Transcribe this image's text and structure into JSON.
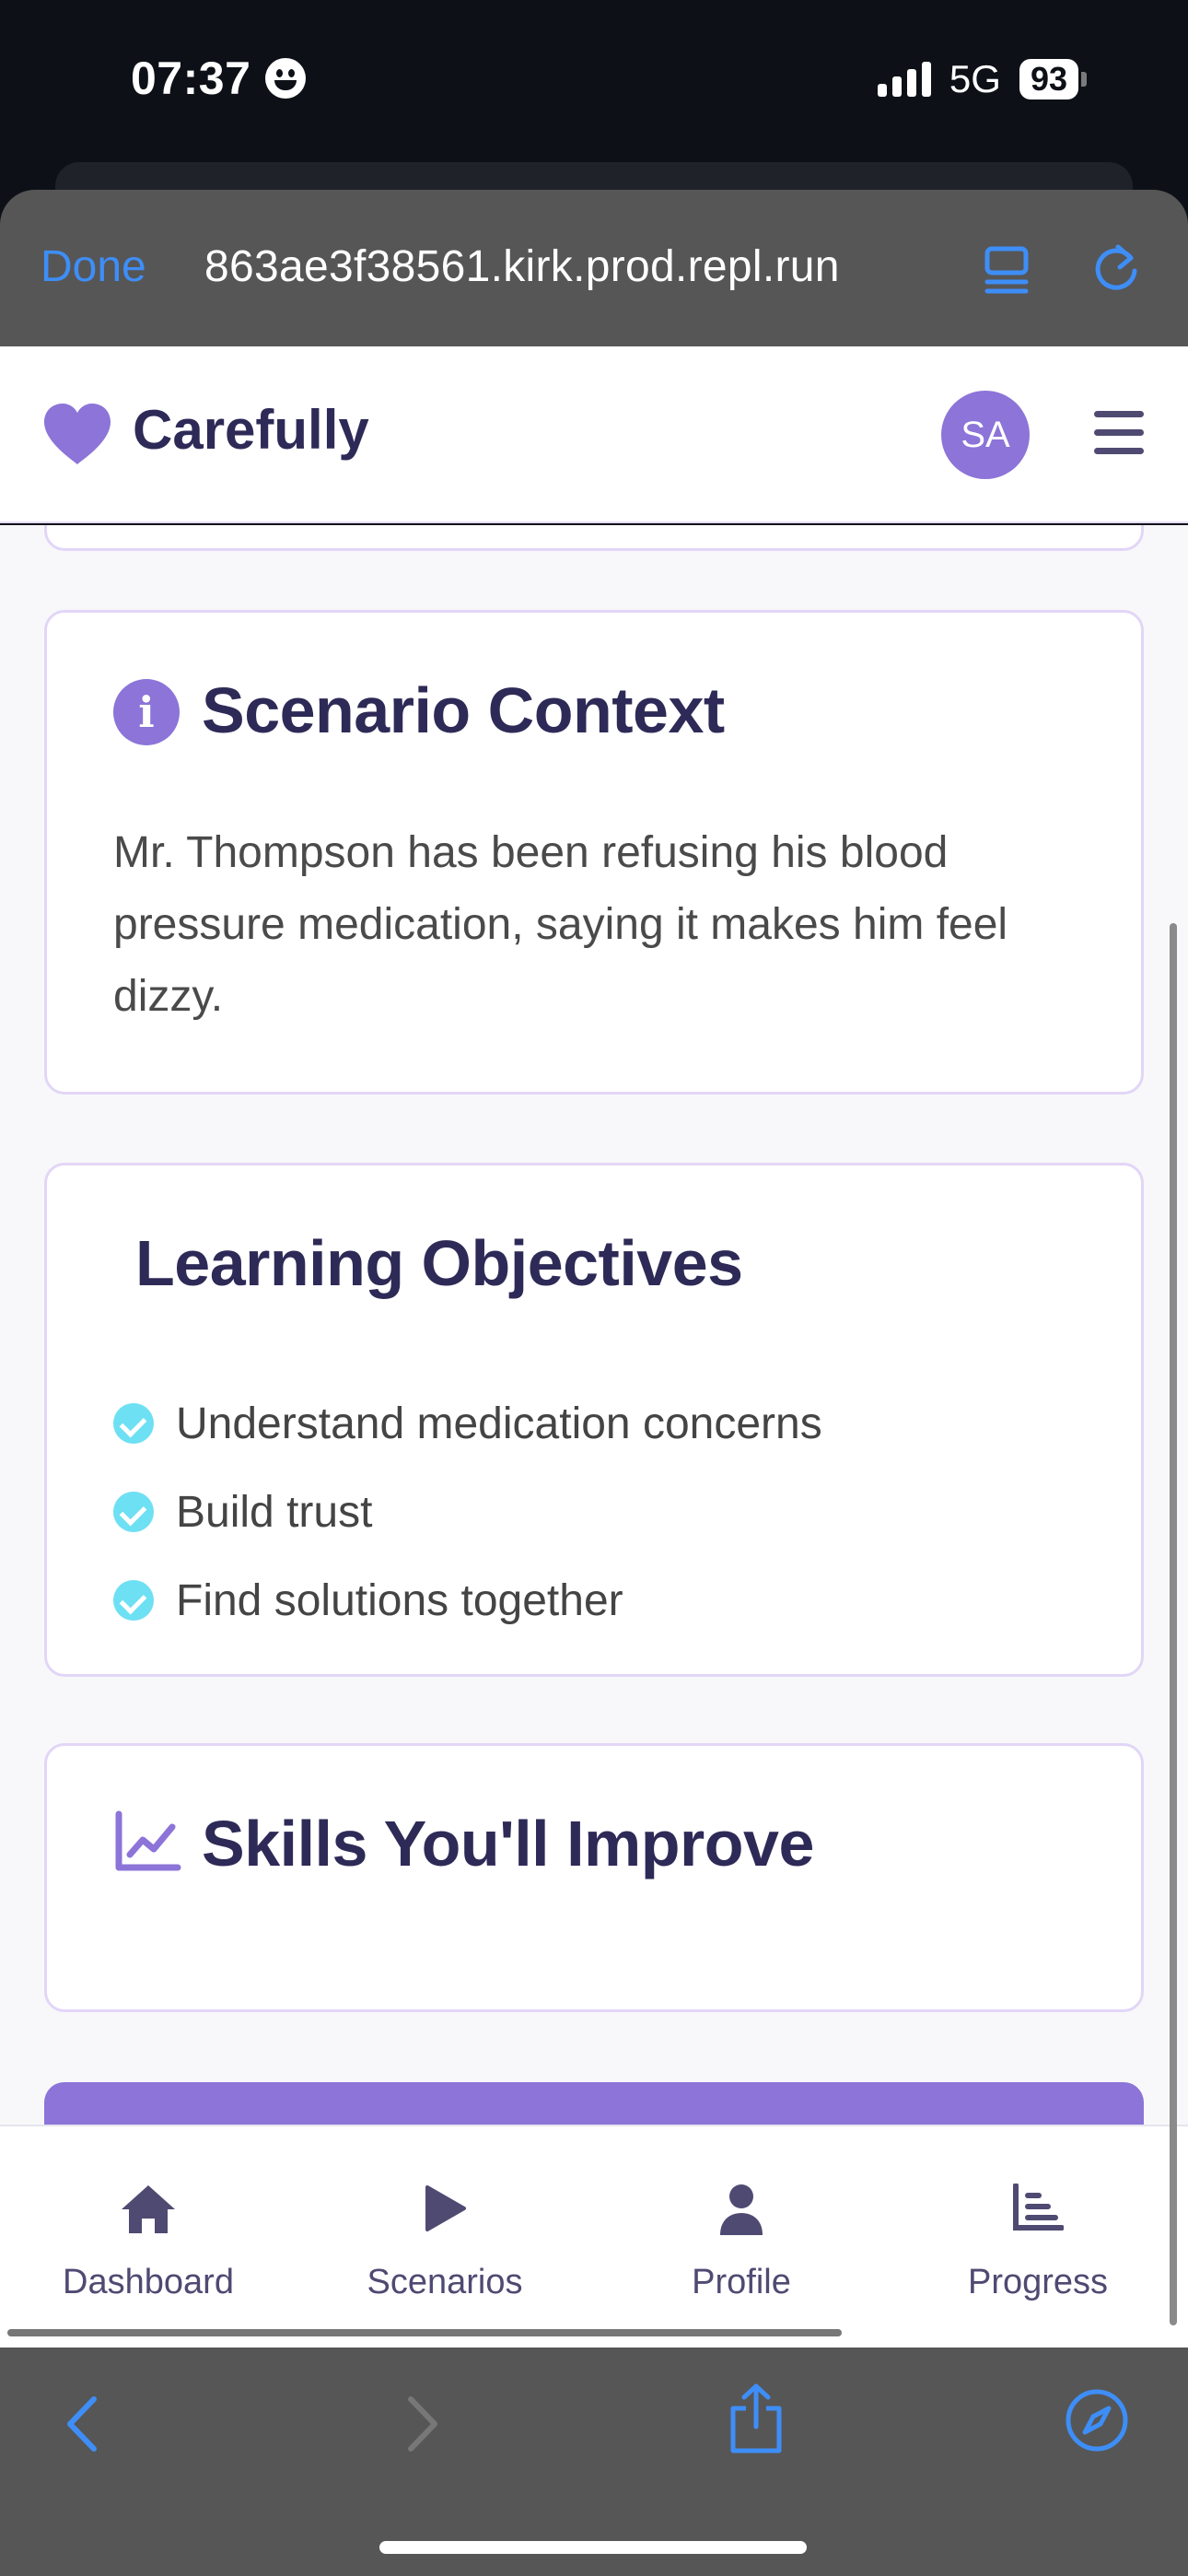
{
  "status_bar": {
    "time": "07:37",
    "network": "5G",
    "battery": "93"
  },
  "browser": {
    "done_label": "Done",
    "url": "863ae3f38561.kirk.prod.repl.run"
  },
  "header": {
    "brand": "Carefully",
    "avatar_initials": "SA"
  },
  "scenario": {
    "title": "Scenario Context",
    "text": "Mr. Thompson has been refusing his blood pressure medication, saying it makes him feel dizzy."
  },
  "objectives": {
    "title": "Learning Objectives",
    "items": [
      "Understand medication concerns",
      "Build trust",
      "Find solutions together"
    ]
  },
  "skills": {
    "title": "Skills You'll Improve"
  },
  "bottom_nav": {
    "items": [
      {
        "label": "Dashboard",
        "icon": "home-icon"
      },
      {
        "label": "Scenarios",
        "icon": "play-icon"
      },
      {
        "label": "Profile",
        "icon": "user-icon"
      },
      {
        "label": "Progress",
        "icon": "bar-chart-icon"
      }
    ]
  },
  "colors": {
    "accent": "#8c74d8",
    "heading": "#2e2a57",
    "check": "#6ee0f3",
    "link_blue": "#3e8ef7"
  }
}
